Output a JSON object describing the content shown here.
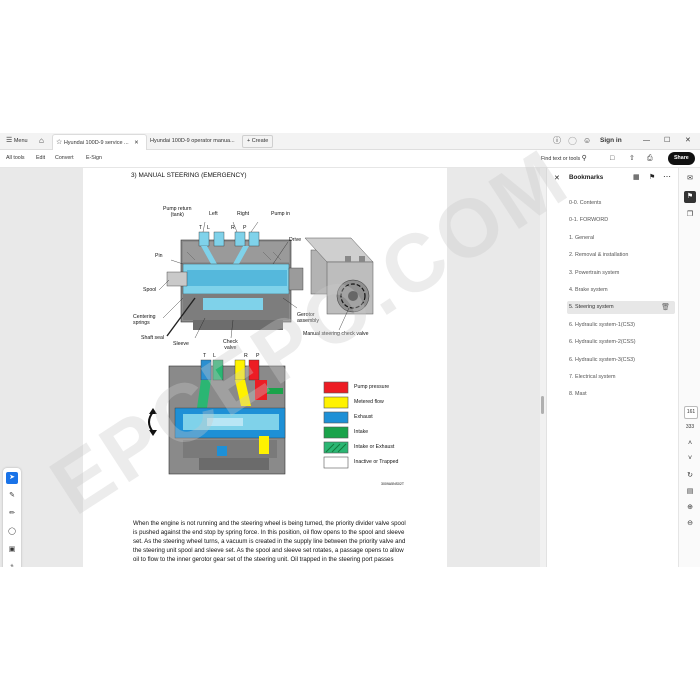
{
  "tabbar": {
    "menu_label": "Menu",
    "tabs": [
      {
        "label": "Hyundai 100D-9 service ...",
        "active": true
      },
      {
        "label": "Hyundai 100D-9 operator manua...",
        "active": false
      }
    ],
    "create_label": "Create",
    "sign_in_label": "Sign in"
  },
  "toolbar": {
    "items": [
      "All tools",
      "Edit",
      "Convert",
      "E-Sign"
    ],
    "find_label": "Find text or tools",
    "share_label": "Share"
  },
  "document": {
    "heading": "3) MANUAL STEERING (EMERGENCY)",
    "top_diagram_labels": {
      "pump_return": "Pump return\n(tank)",
      "left": "Left",
      "right": "Right",
      "pump_in": "Pump in",
      "t": "T",
      "l": "L",
      "r": "R",
      "p": "P",
      "drive": "Drive",
      "pin": "Pin",
      "spool": "Spool",
      "centering_springs": "Centering\nsprings",
      "shaft_seal": "Shaft seal",
      "sleeve": "Sleeve",
      "check_valve": "Check\nvalve",
      "gerotor_assembly": "Gerotor\nassembly",
      "manual_check_valve": "Manual steering check valve"
    },
    "bottom_diagram_labels": {
      "t": "T",
      "l": "L",
      "r": "R",
      "p": "P",
      "code": "3009A5NS02T"
    },
    "legend": [
      {
        "label": "Pump pressure",
        "color": "#ed1c24"
      },
      {
        "label": "Metered flow",
        "color": "#fff200"
      },
      {
        "label": "Exhaust",
        "color": "#1e90d6"
      },
      {
        "label": "Intake",
        "color": "#1aa34a"
      },
      {
        "label": "Intake or Exhaust",
        "color": "#2bb673"
      },
      {
        "label": "Inactive or Trapped",
        "color": "#ffffff"
      }
    ],
    "paragraph": [
      "When the engine is not running and the steering wheel is being turned, the priority divider valve spool",
      "is pushed against the end stop by spring force. In this position, oil flow opens to the spool and sleeve",
      "set. As the steering wheel turns, a vacuum is created in the supply line between the priority valve and",
      "the steering unit spool and sleeve set. As the spool and sleeve set rotates, a passage opens to allow",
      "oil to flow to the inner gerotor gear set of the steering unit. Oil trapped in the steering port passes"
    ],
    "watermark": "EPCEPO.COM"
  },
  "bookmarks": {
    "title": "Bookmarks",
    "items": [
      {
        "label": "0-0. Contents",
        "selected": false
      },
      {
        "label": "0-1. FORWORD",
        "selected": false
      },
      {
        "label": "1. General",
        "selected": false
      },
      {
        "label": "2. Removal & installation",
        "selected": false
      },
      {
        "label": "3. Powertrain system",
        "selected": false
      },
      {
        "label": "4. Brake system",
        "selected": false
      },
      {
        "label": "5. Steering system",
        "selected": true
      },
      {
        "label": "6. Hydraulic system-1(CS3)",
        "selected": false
      },
      {
        "label": "6. Hydraulic system-2(CSS)",
        "selected": false
      },
      {
        "label": "6. Hydraulic system-3(CS3)",
        "selected": false
      },
      {
        "label": "7. Electrical system",
        "selected": false
      },
      {
        "label": "8. Mast",
        "selected": false
      }
    ]
  },
  "pager": {
    "current_page": "161",
    "total_pages": "333"
  }
}
